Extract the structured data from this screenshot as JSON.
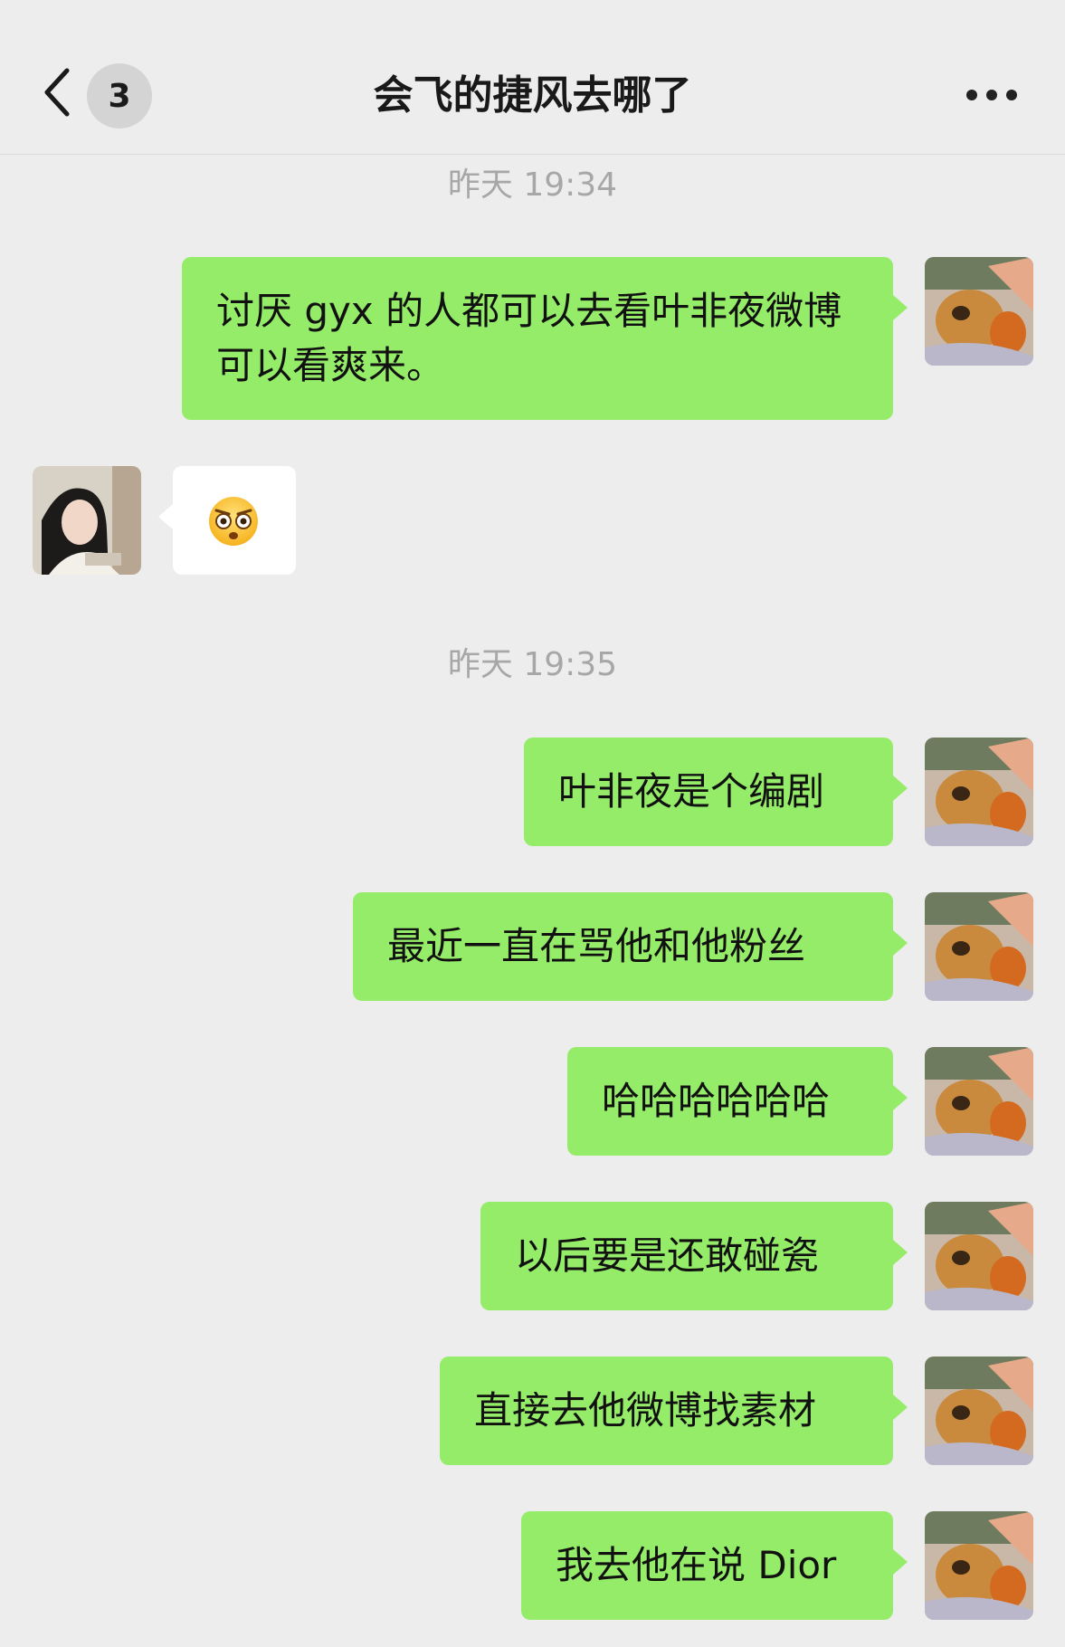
{
  "header": {
    "unread_count": "3",
    "title": "会飞的捷风去哪了"
  },
  "timestamps": [
    "昨天 19:34",
    "昨天 19:35"
  ],
  "messages": [
    {
      "side": "out",
      "text": "讨厌 gyx 的人都可以去看叶非夜微博 可以看爽来。"
    },
    {
      "side": "in",
      "emoji": "flushed-face"
    },
    {
      "side": "out",
      "text": "叶非夜是个编剧"
    },
    {
      "side": "out",
      "text": "最近一直在骂他和他粉丝"
    },
    {
      "side": "out",
      "text": "哈哈哈哈哈哈"
    },
    {
      "side": "out",
      "text": "以后要是还敢碰瓷"
    },
    {
      "side": "out",
      "text": "直接去他微博找素材"
    },
    {
      "side": "out",
      "text": "我去他在说 Dior"
    }
  ],
  "colors": {
    "background": "#ededed",
    "outgoing_bubble": "#95ec69",
    "incoming_bubble": "#ffffff",
    "timestamp": "#a7a7a7"
  },
  "icons": {
    "back": "chevron-left-icon",
    "more": "more-dots-icon",
    "emoji": "flushed-face-emoji"
  }
}
